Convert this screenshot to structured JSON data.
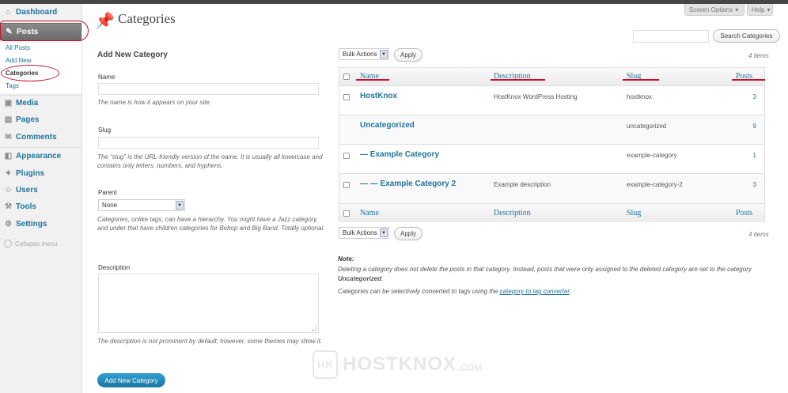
{
  "sidebar": {
    "items": [
      {
        "label": "Dashboard",
        "icon": "dashboard-icon"
      },
      {
        "label": "Posts",
        "icon": "pin-icon"
      },
      {
        "label": "Media",
        "icon": "media-icon"
      },
      {
        "label": "Pages",
        "icon": "pages-icon"
      },
      {
        "label": "Comments",
        "icon": "comments-icon"
      },
      {
        "label": "Appearance",
        "icon": "appearance-icon"
      },
      {
        "label": "Plugins",
        "icon": "plugins-icon"
      },
      {
        "label": "Users",
        "icon": "users-icon"
      },
      {
        "label": "Tools",
        "icon": "tools-icon"
      },
      {
        "label": "Settings",
        "icon": "settings-icon"
      }
    ],
    "posts_submenu": [
      "All Posts",
      "Add New",
      "Categories",
      "Tags"
    ],
    "collapse_label": "Collapse menu"
  },
  "header": {
    "title": "Categories",
    "screen_options": "Screen Options",
    "help": "Help",
    "search_button": "Search Categories"
  },
  "form": {
    "heading": "Add New Category",
    "name_label": "Name",
    "name_help": "The name is how it appears on your site.",
    "slug_label": "Slug",
    "slug_help": "The “slug” is the URL-friendly version of the name. It is usually all lowercase and contains only letters, numbers, and hyphens.",
    "parent_label": "Parent",
    "parent_value": "None",
    "parent_help": "Categories, unlike tags, can have a hierarchy. You might have a Jazz category, and under that have children categories for Bebop and Big Band. Totally optional.",
    "description_label": "Description",
    "description_help": "The description is not prominent by default; however, some themes may show it.",
    "submit": "Add New Category"
  },
  "table": {
    "bulk_actions": "Bulk Actions",
    "apply": "Apply",
    "count": "4 items",
    "columns": [
      "Name",
      "Description",
      "Slug",
      "Posts"
    ],
    "rows": [
      {
        "name": "HostKnox",
        "description": "HostKnox WordPress Hosting",
        "slug": "hostknox",
        "posts": "3"
      },
      {
        "name": "Uncategorized",
        "description": "",
        "slug": "uncategorized",
        "posts": "9"
      },
      {
        "name": "— Example Category",
        "description": "",
        "slug": "example-category",
        "posts": "1"
      },
      {
        "name": "— — Example Category 2",
        "description": "Example description",
        "slug": "example-category-2",
        "posts": "3"
      }
    ]
  },
  "notes": {
    "title": "Note:",
    "text1_a": "Deleting a category does not delete the posts in that category. Instead, posts that were only assigned to the deleted category are set to the category ",
    "text1_b": "Uncategorized",
    "text1_c": ".",
    "text2": "Categories can be selectively converted to tags using the ",
    "link": "category to tag converter",
    "text2_end": "."
  },
  "watermark": {
    "logo": "HK",
    "text": "HOSTKNOX",
    "suffix": ".COM"
  },
  "colors": {
    "link": "#21759b",
    "annotation": "#c8102e",
    "primary": "#21759b"
  }
}
